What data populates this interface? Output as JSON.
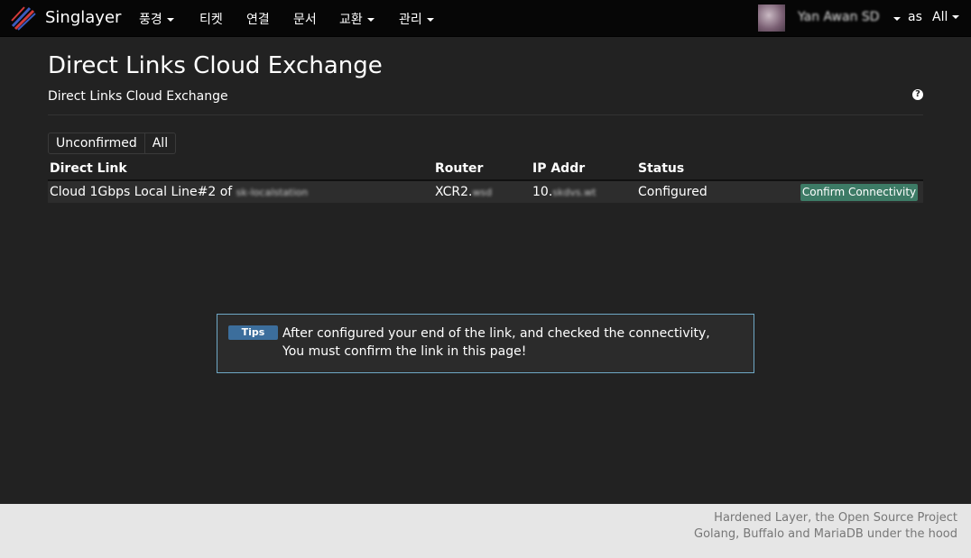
{
  "navbar": {
    "brand": "Singlayer",
    "menu": [
      {
        "label": "풍경",
        "dropdown": true
      },
      {
        "label": "티켓",
        "dropdown": false
      },
      {
        "label": "연결",
        "dropdown": false
      },
      {
        "label": "문서",
        "dropdown": false
      },
      {
        "label": "교환",
        "dropdown": true
      },
      {
        "label": "관리",
        "dropdown": true
      }
    ],
    "user_name": "Yan Awan SD",
    "as_label": "as",
    "scope": "All"
  },
  "page": {
    "title": "Direct Links Cloud Exchange",
    "subtitle": "Direct Links Cloud Exchange",
    "help_icon": "?"
  },
  "filters": [
    "Unconfirmed",
    "All"
  ],
  "table": {
    "headers": [
      "Direct Link",
      "Router",
      "IP Addr",
      "Status"
    ],
    "rows": [
      {
        "link": "Cloud 1Gbps Local Line#2 of",
        "link_redacted": "sk-localstation",
        "router": "XCR2.",
        "router_redacted": "wsd",
        "ip": "10.",
        "ip_redacted": "skdvs.wt",
        "status": "Configured",
        "action": "Confirm Connectivity"
      }
    ]
  },
  "tips": {
    "badge": "Tips",
    "line1": "After configured your end of the link, and checked the connectivity,",
    "line2": "You must confirm the link in this page!"
  },
  "footer": {
    "line1": "Hardened Layer, the Open Source Project",
    "line2": "Golang, Buffalo and MariaDB under the hood"
  },
  "colors": {
    "background": "#222222",
    "navbar": "#060606",
    "confirm_button": "#3d7b66",
    "tips_badge": "#3c6e9c",
    "tips_border": "#6fa8c6",
    "footer": "#e6e6e6"
  }
}
